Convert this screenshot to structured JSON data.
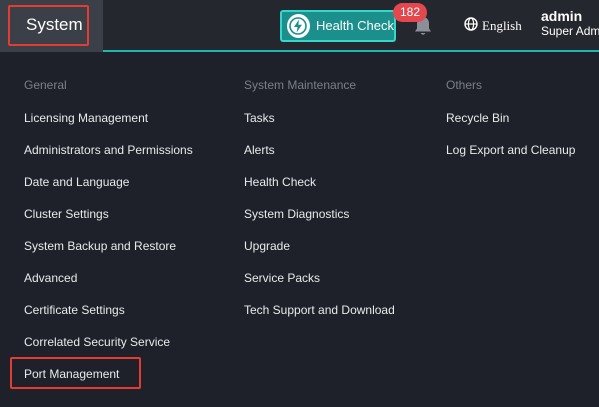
{
  "topbar": {
    "system_label": "System",
    "health_check_label": "Health Check",
    "notification_count": "182",
    "language_label": "English",
    "user_name": "admin",
    "user_role": "Super Adm"
  },
  "menu": {
    "general": {
      "header": "General",
      "items": [
        "Licensing Management",
        "Administrators and Permissions",
        "Date and Language",
        "Cluster Settings",
        "System Backup and Restore",
        "Advanced",
        "Certificate Settings",
        "Correlated Security Service",
        "Port Management"
      ]
    },
    "maintenance": {
      "header": "System Maintenance",
      "items": [
        "Tasks",
        "Alerts",
        "Health Check",
        "System Diagnostics",
        "Upgrade",
        "Service Packs",
        "Tech Support and Download"
      ]
    },
    "others": {
      "header": "Others",
      "items": [
        "Recycle Bin",
        "Log Export and Cleanup"
      ]
    }
  },
  "colors": {
    "accent": "#1fb7b0",
    "highlight": "#e43b33",
    "badge": "#e5474e",
    "background": "#1e2129"
  },
  "icons": {
    "health": "lightning-circle-icon",
    "notification": "bell-icon",
    "language": "globe-icon"
  }
}
